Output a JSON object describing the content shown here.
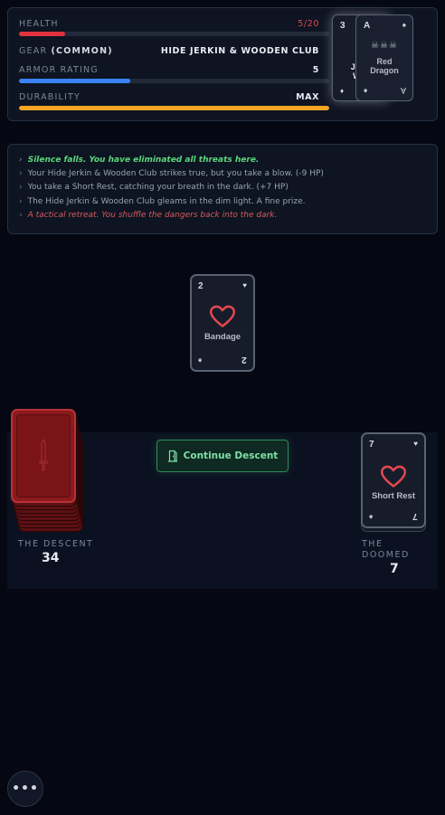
{
  "stats": {
    "health": {
      "label": "HEALTH",
      "value_text": "5/20",
      "current": 3,
      "max": 20,
      "fill_color": "#e0323f",
      "value_color": "#e0474f"
    },
    "gear": {
      "label": "GEAR",
      "tier": "(COMMON)",
      "value": "HIDE JERKIN & WOODEN CLUB"
    },
    "armor": {
      "label": "ARMOR RATING",
      "value": "5",
      "fraction": 0.36,
      "fill_color": "#3b82f6"
    },
    "durability": {
      "label": "DURABILITY",
      "value": "MAX",
      "fraction": 1.0,
      "fill_color": "#f5a524"
    }
  },
  "equipped_cards": {
    "weapon": {
      "rank": "3",
      "suit_glyph": "♦",
      "name_lines": [
        "H",
        "Jerk",
        "Wo",
        "C"
      ]
    },
    "monster": {
      "rank": "A",
      "suit_glyph": "♠",
      "name_lines": [
        "Red",
        "Dragon"
      ],
      "skulls": "☠☠☠",
      "bottom_rank": "A",
      "bottom_suit": "♠"
    }
  },
  "log": [
    {
      "type": "good",
      "text": "Silence falls. You have eliminated all threats here."
    },
    {
      "type": "normal",
      "text": "Your Hide Jerkin & Wooden Club strikes true, but you take a blow. (-9 HP)"
    },
    {
      "type": "normal",
      "text": "You take a Short Rest, catching your breath in the dark. (+7 HP)"
    },
    {
      "type": "normal",
      "text": "The Hide Jerkin & Wooden Club gleams in the dim light. A fine prize."
    },
    {
      "type": "bad",
      "text": "A tactical retreat. You shuffle the dangers back into the dark."
    }
  ],
  "log_arrow": "›",
  "room_card": {
    "rank": "2",
    "suit_glyph": "♥",
    "name": "Bandage",
    "bottom_suit": "♠",
    "bottom_rank": "2"
  },
  "descent": {
    "label": "THE DESCENT",
    "count": "34"
  },
  "continue_button": {
    "label": "Continue Descent",
    "icon": "door-icon"
  },
  "doomed": {
    "label_line1": "THE",
    "label_line2": "DOOMED",
    "count": "7",
    "top_card": {
      "rank": "7",
      "suit_glyph": "♥",
      "name": "Short Rest",
      "bottom_suit": "♠",
      "bottom_rank": "7"
    }
  },
  "menu": {
    "label": "•••",
    "icon": "more-icon"
  },
  "colors": {
    "heart": "#e0474f",
    "accent_green": "#2f8a5e",
    "deck_red": "#8d1a1d"
  }
}
